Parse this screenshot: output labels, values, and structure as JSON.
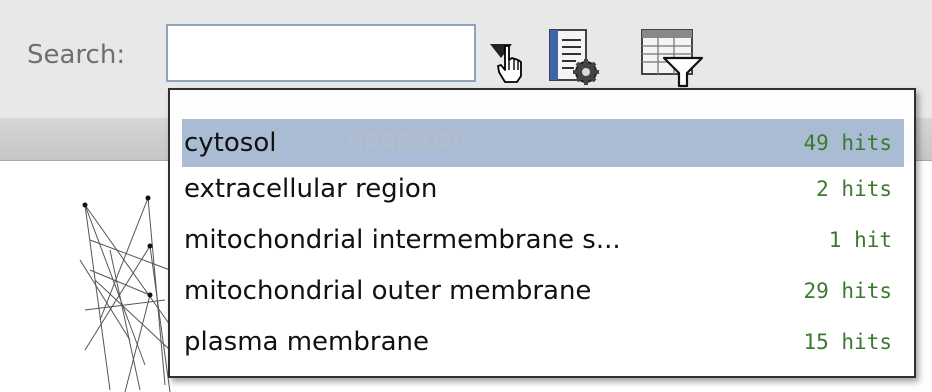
{
  "search": {
    "label": "Search:",
    "value": "",
    "placeholder": ""
  },
  "toolbar": {
    "settings_icon": "document-gear-icon",
    "filter_icon": "table-filter-icon"
  },
  "background_label": "Apoptosis",
  "suggestions": [
    {
      "term": "cytosol",
      "hits": "49 hits",
      "selected": true
    },
    {
      "term": "extracellular region",
      "hits": "2 hits",
      "selected": false
    },
    {
      "term": "mitochondrial intermembrane s...",
      "hits": "1 hit",
      "selected": false
    },
    {
      "term": "mitochondrial outer membrane",
      "hits": "29 hits",
      "selected": false
    },
    {
      "term": "plasma membrane",
      "hits": "15 hits",
      "selected": false
    }
  ],
  "colors": {
    "selection": "#a9bcd4",
    "hits_text": "#3b7a2e",
    "input_border": "#8fa3bd"
  }
}
